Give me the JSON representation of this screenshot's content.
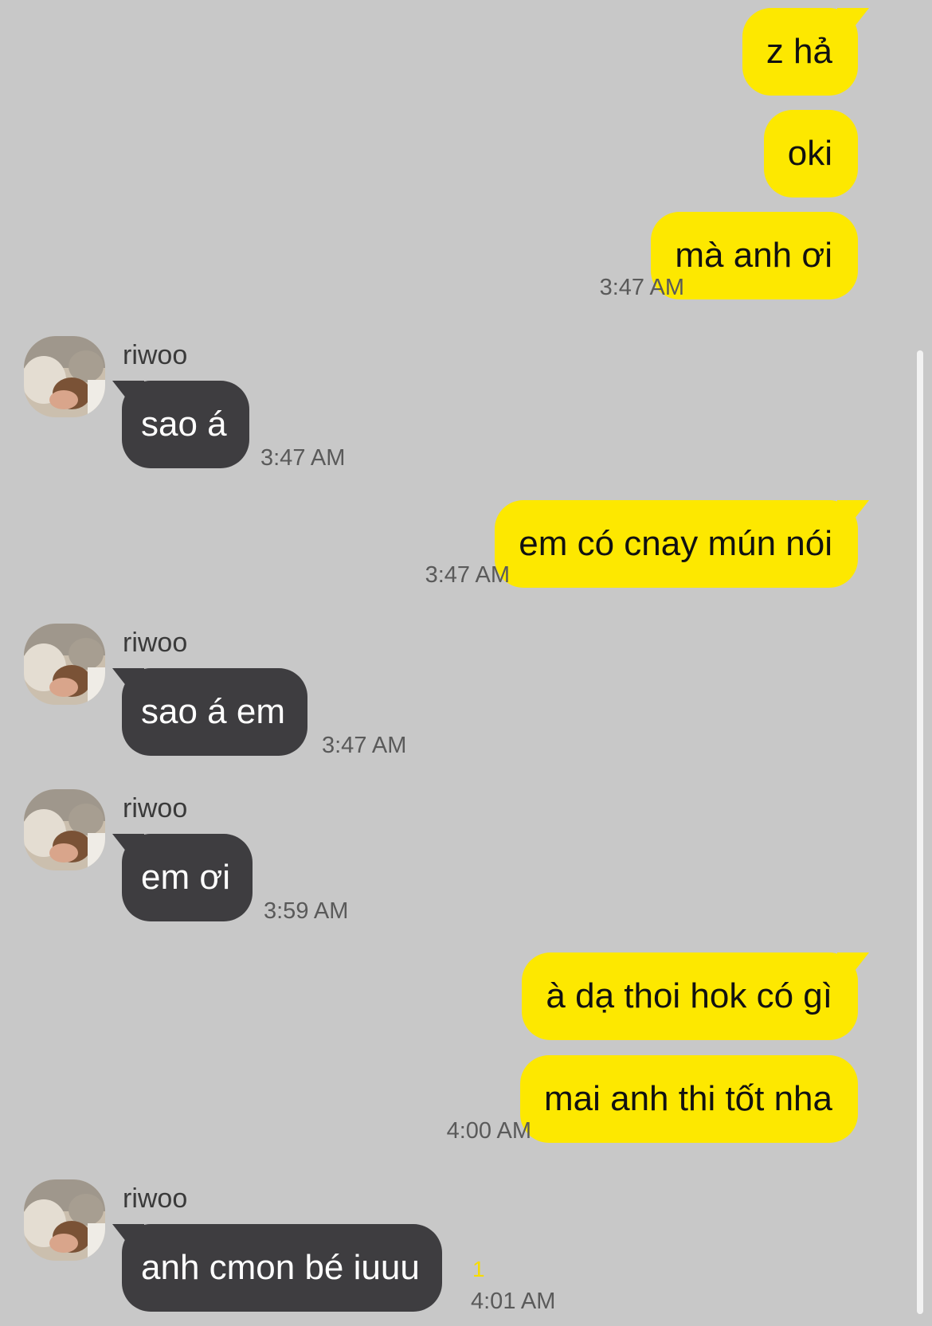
{
  "chat": {
    "messages": [
      {
        "from": "me",
        "text": "z hả"
      },
      {
        "from": "me",
        "text": "oki"
      },
      {
        "from": "me",
        "text": "mà anh ơi",
        "time": "3:47 AM"
      },
      {
        "from": "riwoo",
        "text": "sao á",
        "time": "3:47 AM"
      },
      {
        "from": "me",
        "text": "em có cnay mún nói",
        "time": "3:47 AM"
      },
      {
        "from": "riwoo",
        "text": "sao á em",
        "time": "3:47 AM"
      },
      {
        "from": "riwoo",
        "text": "em ơi",
        "time": "3:59 AM"
      },
      {
        "from": "me",
        "text": "à dạ thoi hok có gì"
      },
      {
        "from": "me",
        "text": "mai anh thi tốt nha",
        "time": "4:00 AM"
      },
      {
        "from": "riwoo",
        "text": "anh cmon bé iuuu",
        "time": "4:01 AM",
        "unread_count": "1"
      }
    ],
    "sender_name": "riwoo"
  },
  "colors": {
    "background": "#c8c8c8",
    "my_bubble": "#fde800",
    "their_bubble": "#3e3d40",
    "unread": "#f7dc00"
  },
  "icons": {
    "avatar": "profile-photo"
  }
}
